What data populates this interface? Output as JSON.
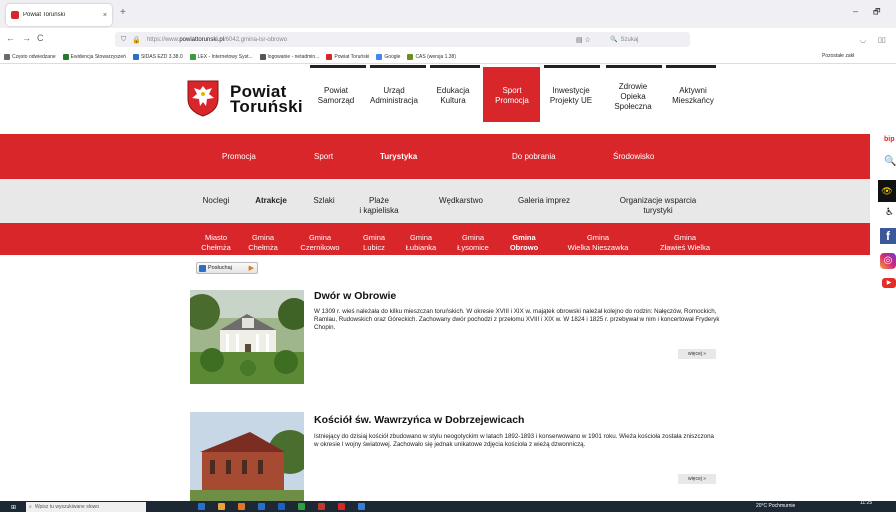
{
  "browser": {
    "tab_title": "Powiat Toruński",
    "tab_close": "×",
    "new_tab": "+",
    "url_prefix": "https://www.",
    "url_domain": "powiattorunski.pl",
    "url_path": "/6042,gmina-lsr-obrowo",
    "search_placeholder": "Szukaj",
    "win_min": "–",
    "win_max": "🗗",
    "back": "←",
    "forward": "→",
    "reload": "C",
    "bookmarks": [
      {
        "label": "Często odwiedzane",
        "color": "#6b6b6b"
      },
      {
        "label": "Ewidencja Stowarzyszeń",
        "color": "#2b7a2b"
      },
      {
        "label": "SIDAS EZD 3.38.0",
        "color": "#2c6ecb"
      },
      {
        "label": "LEX - Internetowy Syst...",
        "color": "#3a9b3a"
      },
      {
        "label": "logowanie - netadmin...",
        "color": "#555555"
      },
      {
        "label": "Powiat Toruński",
        "color": "#d8262b"
      },
      {
        "label": "Google",
        "color": "#4285f4"
      },
      {
        "label": "CAS (wersja 1.38)",
        "color": "#6b8e23"
      }
    ],
    "bookmarks_other": "Pozostałe zakł"
  },
  "site": {
    "logo_line1": "Powiat",
    "logo_line2": "Toruński",
    "main_nav": [
      {
        "line1": "Powiat",
        "line2": "Samorząd",
        "line3": ""
      },
      {
        "line1": "Urząd",
        "line2": "Administracja",
        "line3": ""
      },
      {
        "line1": "Edukacja",
        "line2": "Kultura",
        "line3": ""
      },
      {
        "line1": "Sport",
        "line2": "Promocja",
        "line3": ""
      },
      {
        "line1": "Inwestycje",
        "line2": "Projekty UE",
        "line3": ""
      },
      {
        "line1": "Zdrowie",
        "line2": "Opieka",
        "line3": "Społeczna"
      },
      {
        "line1": "Aktywni",
        "line2": "Mieszkańcy",
        "line3": ""
      }
    ],
    "sub_nav1": [
      "Promocja",
      "Sport",
      "Turystyka",
      "Do pobrania",
      "Środowisko"
    ],
    "sub_nav2": [
      {
        "line1": "Noclegi",
        "line2": ""
      },
      {
        "line1": "Atrakcje",
        "line2": ""
      },
      {
        "line1": "Szlaki",
        "line2": ""
      },
      {
        "line1": "Plaże",
        "line2": "i kąpieliska"
      },
      {
        "line1": "Wędkarstwo",
        "line2": ""
      },
      {
        "line1": "Galeria imprez",
        "line2": ""
      },
      {
        "line1": "Organizacje wsparcia",
        "line2": "turystyki"
      }
    ],
    "sub_nav3": [
      {
        "line1": "Miasto",
        "line2": "Chełmża"
      },
      {
        "line1": "Gmina",
        "line2": "Chełmża"
      },
      {
        "line1": "Gmina",
        "line2": "Czernikowo"
      },
      {
        "line1": "Gmina",
        "line2": "Lubicz"
      },
      {
        "line1": "Gmina",
        "line2": "Łubianka"
      },
      {
        "line1": "Gmina",
        "line2": "Łysomice"
      },
      {
        "line1": "Gmina",
        "line2": "Obrowo"
      },
      {
        "line1": "Gmina",
        "line2": "Wielka Nieszawka"
      },
      {
        "line1": "Gmina",
        "line2": "Zławieś Wielka"
      }
    ],
    "side": {
      "bip": "bip",
      "search": "🔍",
      "contrast": "👁",
      "access": "♿",
      "fb": "f",
      "ig": "◎",
      "yt": "▶"
    },
    "listen_label": "Posłuchaj",
    "listen_play": "▶"
  },
  "articles": [
    {
      "title": "Dwór w Obrowie",
      "text": "W 1309 r. wieś należała do kilku mieszczan toruńskich. W okresie XVIII i XIX w. majątek obrowski należał kolejno do rodzin: Nałęczów, Romockich, Ramlau, Rudowskich oraz Góreckich. Zachowany dwór pochodzi z przełomu XVIII i XIX w. W 1824 i 1825 r. przebywał w nim i koncertował Fryderyk Chopin.",
      "more": "więcej »"
    },
    {
      "title": "Kościół św. Wawrzyńca w Dobrzejewicach",
      "text": "Istniejący do dzisiaj kościół zbudowano w stylu neogotyckim w latach 1892-1893 i konserwowano w 1901 roku. Wieża kościoła została zniszczona w okresie I wojny światowej. Zachowało się jednak unikatowe zdjęcia kościoła z wieżą dzwonniczą.",
      "more": "więcej »"
    }
  ],
  "taskbar": {
    "start": "⊞",
    "search": "Wpisz tu wyszukiwane słowo",
    "tray": "20°C Pochmurnie",
    "time": "11:25"
  }
}
